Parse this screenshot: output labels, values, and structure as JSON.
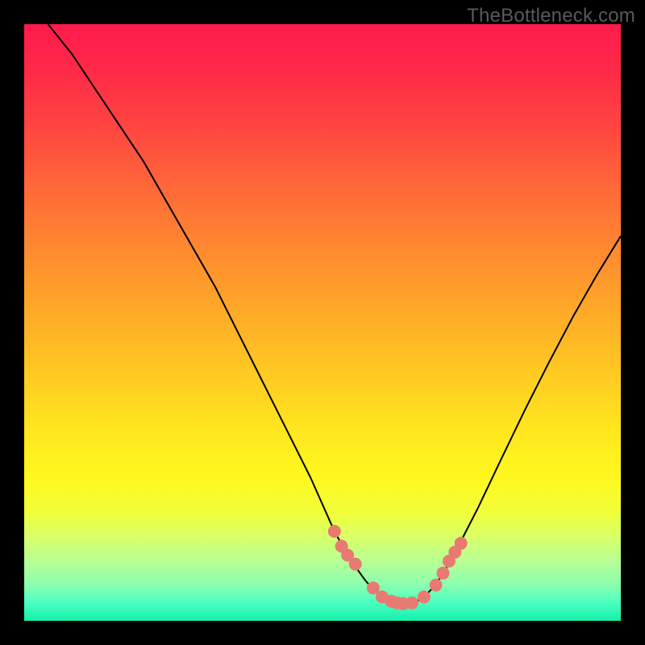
{
  "watermark": "TheBottleneck.com",
  "chart_data": {
    "type": "line",
    "title": "",
    "xlabel": "",
    "ylabel": "",
    "xlim": [
      0,
      100
    ],
    "ylim": [
      0,
      100
    ],
    "grid": false,
    "series": [
      {
        "name": "curve",
        "x": [
          4,
          8,
          12,
          16,
          20,
          24,
          28,
          32,
          36,
          40,
          44,
          48,
          52,
          53,
          54,
          55,
          56,
          57,
          58,
          59,
          60,
          61,
          62,
          63,
          64,
          65,
          66,
          67,
          68,
          69,
          70,
          72,
          76,
          80,
          84,
          88,
          92,
          96,
          100
        ],
        "y": [
          100,
          95,
          89,
          83,
          77,
          70,
          63,
          56,
          48,
          40,
          32,
          24,
          15,
          13.2,
          11.5,
          9.9,
          8.4,
          7.0,
          5.8,
          4.8,
          4.0,
          3.4,
          3.0,
          2.8,
          2.8,
          3.0,
          3.4,
          4.1,
          5.0,
          6.2,
          7.6,
          11.0,
          18.8,
          27.2,
          35.5,
          43.4,
          51.0,
          58.0,
          64.5
        ]
      }
    ],
    "highlight_points": {
      "name": "markers",
      "x": [
        52.0,
        53.2,
        54.2,
        55.5,
        58.5,
        60.0,
        61.5,
        62.5,
        63.5,
        65.0,
        67.0,
        69.0,
        70.2,
        71.2,
        72.2,
        73.2
      ],
      "y": [
        15.0,
        12.5,
        11.0,
        9.5,
        5.5,
        4.0,
        3.3,
        3.0,
        2.9,
        3.0,
        4.0,
        6.0,
        8.0,
        10.0,
        11.5,
        13.0
      ]
    },
    "background_gradient": {
      "top": "#ff1a4d",
      "mid": "#ffe61e",
      "bottom": "#14f0a8"
    }
  }
}
